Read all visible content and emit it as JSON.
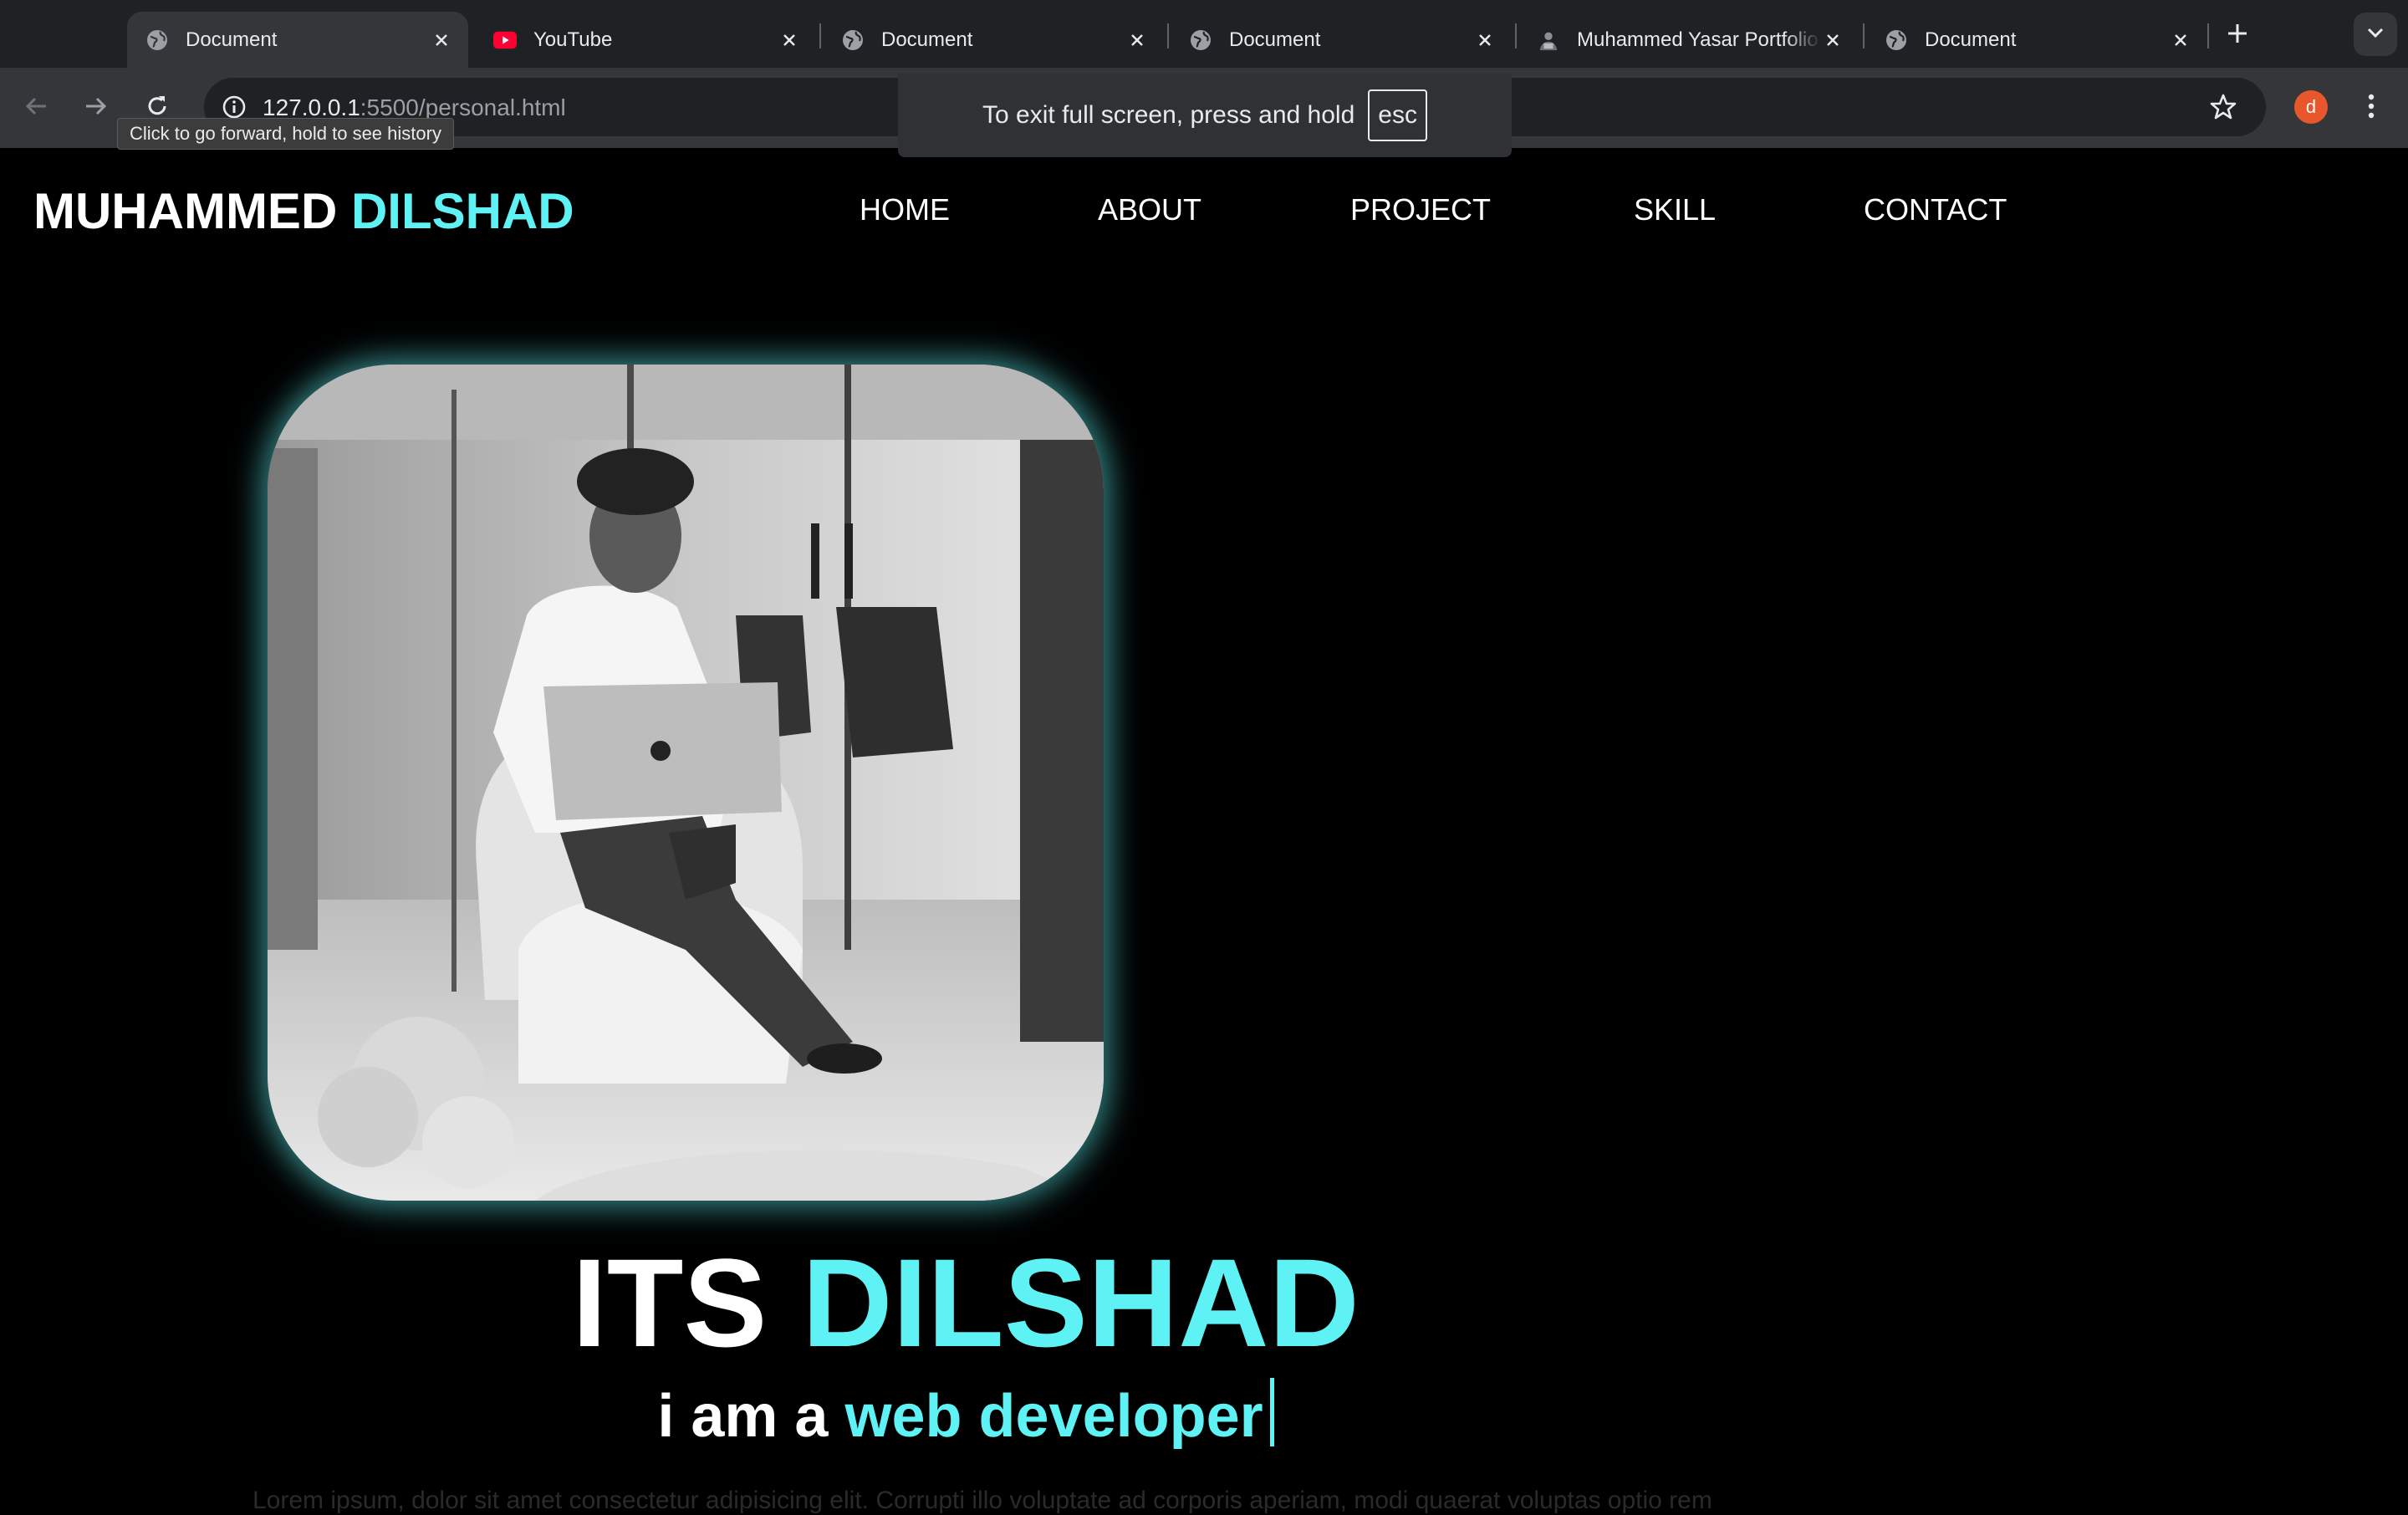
{
  "browser": {
    "tabs": [
      {
        "title": "Document",
        "icon": "globe-icon",
        "active": true
      },
      {
        "title": "YouTube",
        "icon": "youtube-icon",
        "active": false
      },
      {
        "title": "Document",
        "icon": "globe-icon",
        "active": false
      },
      {
        "title": "Document",
        "icon": "globe-icon",
        "active": false
      },
      {
        "title": "Muhammed Yasar Portfolio",
        "icon": "avatar-favicon-icon",
        "active": false
      },
      {
        "title": "Document",
        "icon": "globe-icon",
        "active": false
      }
    ],
    "url_host": "127.0.0.1",
    "url_rest": ":5500/personal.html",
    "profile_initial": "d",
    "tooltip": "Click to go forward, hold to see history",
    "fullscreen_message": "To exit full screen, press and hold",
    "fullscreen_key": "esc"
  },
  "page": {
    "logo_first": "MUHAMMED",
    "logo_second": "DILSHAD",
    "nav": [
      "HOME",
      "ABOUT",
      "PROJECT",
      "SKILL",
      "CONTACT"
    ],
    "headline_first": "ITS",
    "headline_second": "DILSHAD",
    "subline_first": "i am a",
    "subline_second": "web developer",
    "body_text": "Lorem ipsum, dolor sit amet consectetur adipisicing elit. Corrupti illo voluptate ad corporis aperiam, modi quaerat voluptas optio rem",
    "photo_alt": "Person sitting in a chair working on a laptop",
    "colors": {
      "accent": "#5ff2f4",
      "background": "#000000"
    }
  }
}
